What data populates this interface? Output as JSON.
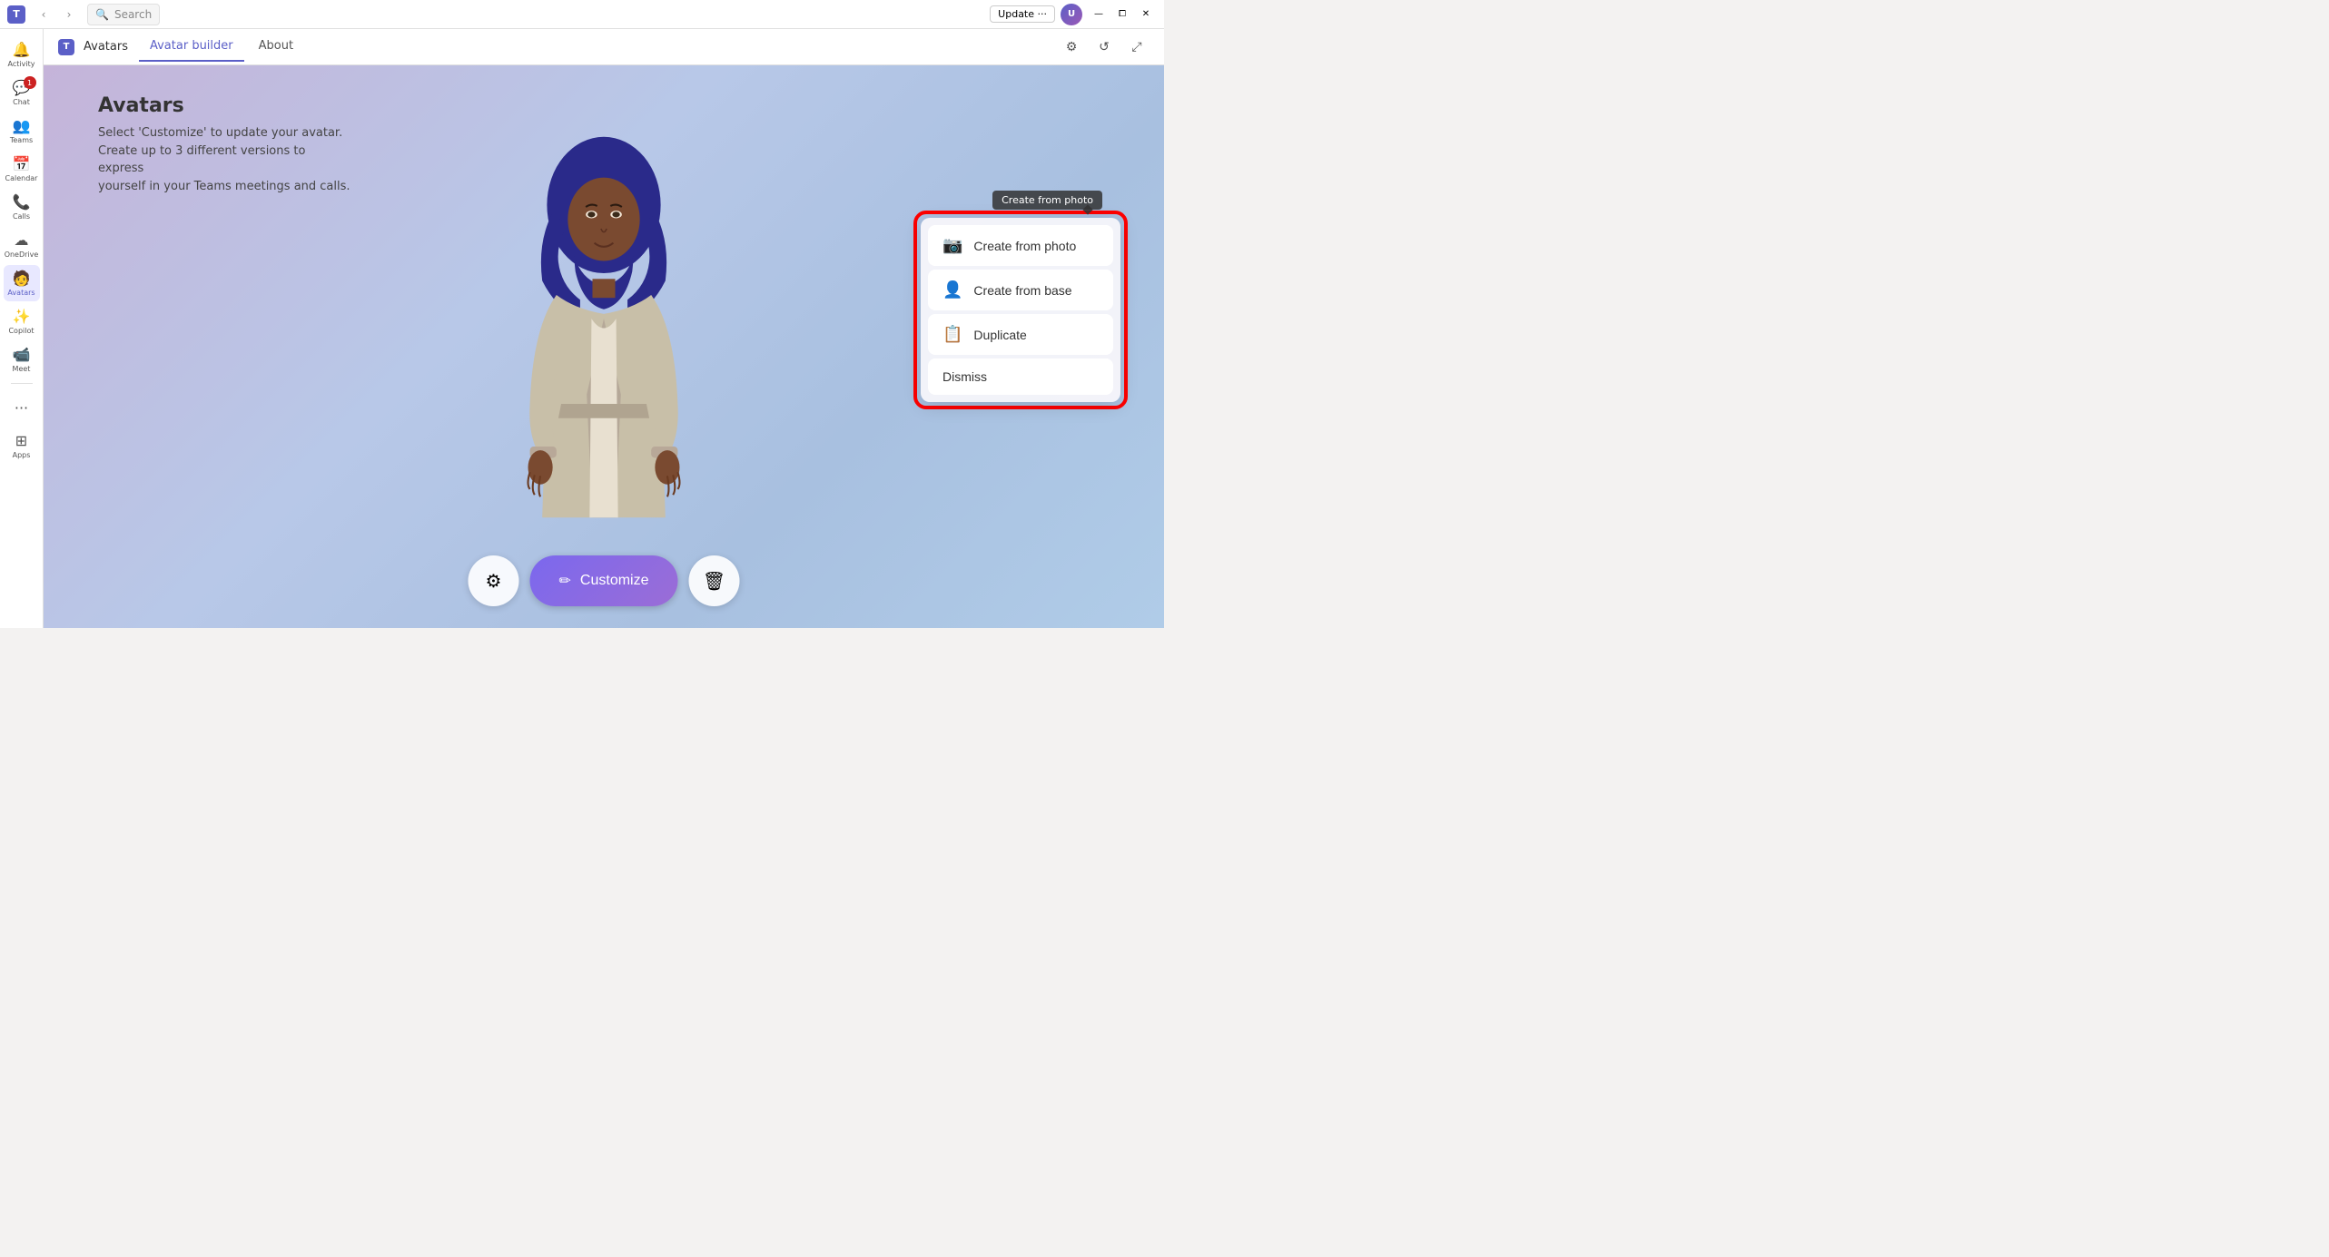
{
  "titlebar": {
    "update_label": "Update ···",
    "search_placeholder": "Search"
  },
  "sidebar": {
    "items": [
      {
        "id": "activity",
        "label": "Activity",
        "icon": "🔔",
        "badge": null
      },
      {
        "id": "chat",
        "label": "Chat",
        "icon": "💬",
        "badge": "1"
      },
      {
        "id": "teams",
        "label": "Teams",
        "icon": "👥",
        "badge": null
      },
      {
        "id": "calendar",
        "label": "Calendar",
        "icon": "📅",
        "badge": null
      },
      {
        "id": "calls",
        "label": "Calls",
        "icon": "📞",
        "badge": null
      },
      {
        "id": "onedrive",
        "label": "OneDrive",
        "icon": "☁",
        "badge": null
      },
      {
        "id": "avatars",
        "label": "Avatars",
        "icon": "🧑",
        "badge": null,
        "active": true
      },
      {
        "id": "copilot",
        "label": "Copilot",
        "icon": "✨",
        "badge": null
      },
      {
        "id": "meet",
        "label": "Meet",
        "icon": "📹",
        "badge": null
      },
      {
        "id": "more",
        "label": "···",
        "icon": "···",
        "badge": null
      },
      {
        "id": "apps",
        "label": "Apps",
        "icon": "⊞",
        "badge": null
      }
    ]
  },
  "tabs": {
    "app_name": "Avatars",
    "items": [
      {
        "id": "avatar-builder",
        "label": "Avatar builder",
        "active": true
      },
      {
        "id": "about",
        "label": "About",
        "active": false
      }
    ]
  },
  "page": {
    "title": "Avatars",
    "description_line1": "Select 'Customize' to update your avatar.",
    "description_line2": "Create up to 3 different versions to express",
    "description_line3": "yourself in your Teams meetings and calls."
  },
  "bottom_toolbar": {
    "settings_icon": "⚙",
    "customize_label": "Customize",
    "customize_icon": "✏",
    "delete_icon": "🗑"
  },
  "dropdown": {
    "tooltip": "Create from photo",
    "items": [
      {
        "id": "create-from-photo",
        "label": "Create from photo",
        "icon": "📷"
      },
      {
        "id": "create-from-base",
        "label": "Create from base",
        "icon": "👤"
      },
      {
        "id": "duplicate",
        "label": "Duplicate",
        "icon": "📋"
      },
      {
        "id": "dismiss",
        "label": "Dismiss",
        "icon": null
      }
    ]
  },
  "colors": {
    "accent": "#5b5fc7",
    "gradient_start": "#c5b4d9",
    "gradient_end": "#a8c0e0",
    "highlight_red": "#ff0000",
    "customize_btn_start": "#7b68ee",
    "customize_btn_end": "#9b6dd6"
  }
}
